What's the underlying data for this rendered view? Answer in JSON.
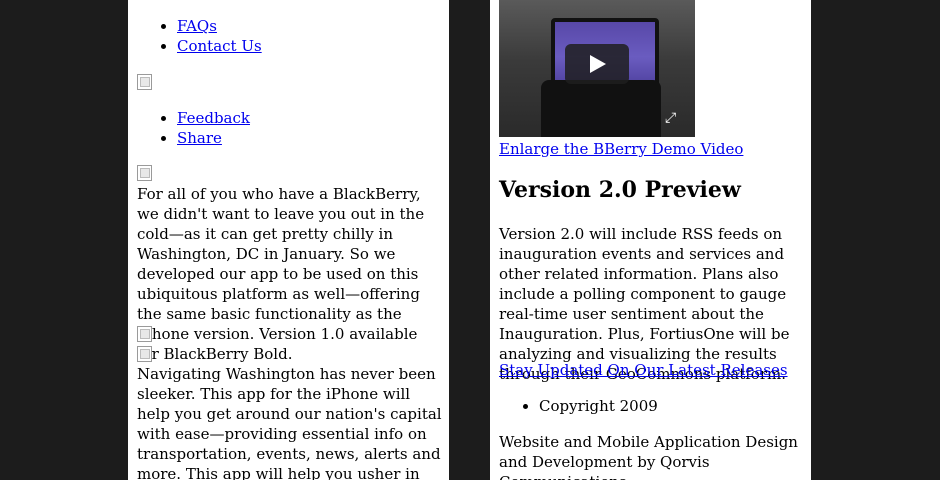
{
  "left": {
    "nav_top": [
      {
        "label": "FAQs"
      },
      {
        "label": "Contact Us"
      }
    ],
    "nav_bottom": [
      {
        "label": "Feedback"
      },
      {
        "label": "Share"
      }
    ],
    "blackberry_text": "For all of you who have a BlackBerry, we didn't want to leave you out in the cold—as it can get pretty chilly in Washington, DC in January. So we developed our app to be used on this ubiquitous platform as well—offering the same basic functionality as the iPhone version. Version 1.0 available for BlackBerry Bold.",
    "iphone_text": "Navigating Washington has never been sleeker. This app for the iPhone will help you get around our nation's capital with ease—providing essential info on transportation, events, news, alerts and more. This app will help you usher in the nation's first high-tech president."
  },
  "right": {
    "enlarge_link": "Enlarge the BBerry Demo Video",
    "preview_title": "Version 2.0 Preview",
    "preview_text": "Version 2.0 will include RSS feeds on inauguration events and services and other related information. Plans also include a polling component to gauge real-time user sentiment about the Inauguration. Plus, FortiusOne will be analyzing and visualizing the results through their GeoCommons platform.",
    "updates_link": "Stay Updated On Our Latest Releases",
    "copyright": "Copyright 2009",
    "credits": "Website and Mobile Application Design and Development by Qorvis Communications"
  },
  "icons": {
    "play": "play-icon",
    "fullscreen": "fullscreen-icon"
  }
}
